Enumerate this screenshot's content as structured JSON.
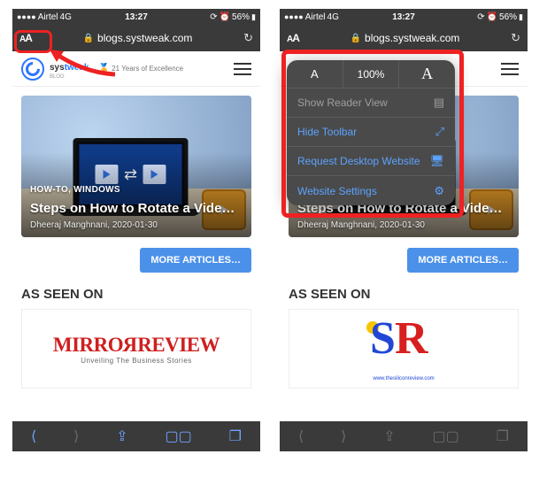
{
  "status": {
    "carrier": "Airtel",
    "net": "4G",
    "time": "13:27",
    "alarm": "⏰",
    "battery_pct": "56%"
  },
  "urlbar": {
    "aa": "AA",
    "url": "blogs.systweak.com"
  },
  "header": {
    "brand_a": "sys",
    "brand_b": "tweak",
    "blog": "BLOG",
    "excel": "21 Years of Excellence"
  },
  "article": {
    "tags": "HOW-TO, WINDOWS",
    "title": "Steps on How to Rotate a Vide…",
    "byline": "Dheeraj Manghnani, 2020-01-30"
  },
  "more": "MORE ARTICLES…",
  "seen_label": "AS SEEN ON",
  "mirror": {
    "text_a": "MIRRO",
    "text_r": "R",
    "text_b": "REVIEW",
    "sub": "Unveiling The Business Stories"
  },
  "sr": {
    "url": "www.thesiliconreview.com"
  },
  "aa_menu": {
    "zoom": "100%",
    "reader": "Show Reader View",
    "hide": "Hide Toolbar",
    "desktop": "Request Desktop Website",
    "settings": "Website Settings"
  }
}
